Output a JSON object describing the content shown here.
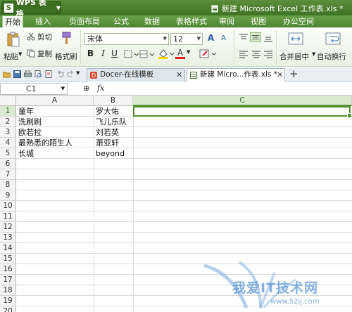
{
  "titlebar": {
    "app_logo": "S",
    "app_name": "WPS 表格",
    "document_title": "新建 Microsoft Excel 工作表.xls *"
  },
  "menu": {
    "tabs": [
      "开始",
      "插入",
      "页面布局",
      "公式",
      "数据",
      "表格样式",
      "审阅",
      "视图",
      "办公空间"
    ]
  },
  "ribbon": {
    "paste": "粘贴",
    "cut": "剪切",
    "copy": "复制",
    "format_painter": "格式刷",
    "font_name": "宋体",
    "font_size": "12",
    "bold": "B",
    "italic": "I",
    "underline": "U",
    "merge_center": "合并居中",
    "wrap_text": "自动换行",
    "font_color_letter": "A",
    "grow_font": "A",
    "shrink_font": "A"
  },
  "doc_tabs": [
    {
      "label": "Docer-在线模板",
      "active": false
    },
    {
      "label": "新建 Micro...作表.xls *",
      "active": true
    }
  ],
  "formula_bar": {
    "name_box": "C1",
    "zoom_icon": "⊕",
    "fx": "fx",
    "value": ""
  },
  "sheet": {
    "columns": [
      "A",
      "B",
      "C"
    ],
    "selected_column": "C",
    "rows": [
      "1",
      "2",
      "3",
      "4",
      "5",
      "6",
      "7",
      "8",
      "9",
      "10",
      "11",
      "12",
      "13",
      "14",
      "15",
      "16",
      "17",
      "18",
      "19",
      "20"
    ],
    "selected_row": "1",
    "col_a": [
      "童年",
      "洗刷刷",
      "欧若拉",
      "最熟悉的陌生人",
      "长城"
    ],
    "col_b": [
      "罗大佑",
      "飞儿乐队",
      "刘若英",
      "萧亚轩",
      "beyond"
    ]
  },
  "watermark": {
    "text": "我爱IT技术网",
    "url": "www.52ij.com"
  },
  "colors": {
    "accent_green": "#4f8f2e",
    "titlebar_green": "#3f7325",
    "selection_fill": "#d9ead0"
  }
}
